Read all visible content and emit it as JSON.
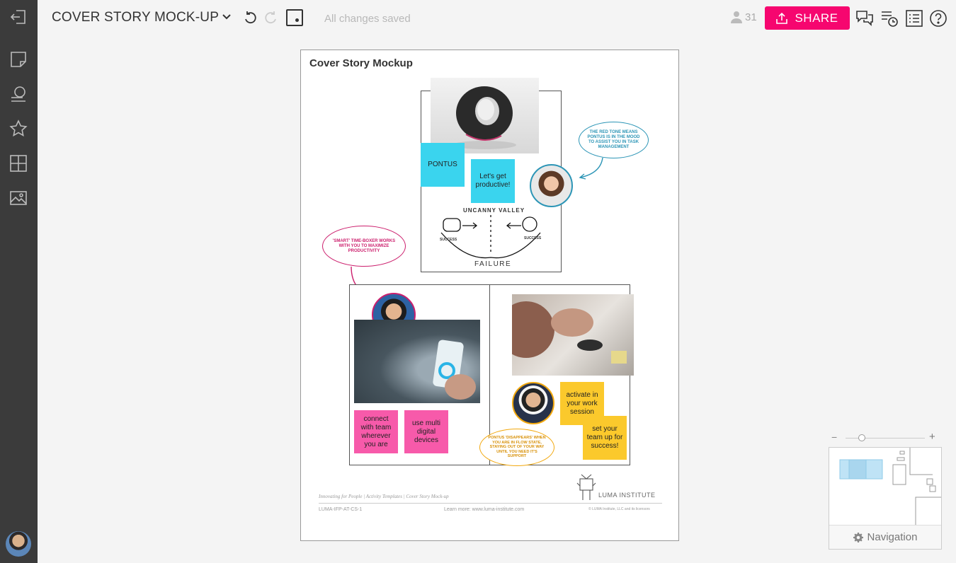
{
  "header": {
    "title": "COVER STORY MOCK-UP",
    "save_status": "All changes saved",
    "user_count": "31",
    "share_label": "SHARE"
  },
  "board": {
    "title": "Cover Story Mockup",
    "stickies": {
      "pontus": "PONTUS",
      "productive": "Let's get productive!",
      "connect": "connect with team wherever you are",
      "multi": "use multi digital devices",
      "activate": "activate in your work session",
      "setup": "set your team up for success!"
    },
    "bubbles": {
      "red_tone": "The red tone means Pontus is in the mood to assist you in task management",
      "smart": "'Smart' time-boxer works with you to maximize productivity",
      "disappears": "Pontus 'disappears' when you are in flow state, staying out of your way until you need it's support"
    },
    "sketch": {
      "top_label": "UNCANNY VALLEY",
      "bottom_label": "FAILURE",
      "left_label": "SUCCESS",
      "right_label": "SUCCESS"
    },
    "footer": {
      "left": "Innovating for People | Activity Templates | Cover Story Mock-up",
      "code": "LUMA-IFP-AT-CS-1",
      "learn_more": "Learn more: www.luma-institute.com",
      "copyright": "© LUMA Institute, LLC and its licensors",
      "logo_text": "LUMA INSTITUTE"
    }
  },
  "navigation": {
    "label": "Navigation",
    "zoom_minus": "−",
    "zoom_plus": "+"
  },
  "colors": {
    "accent": "#f6066f",
    "sidebar": "#3b3b3b",
    "cyan_sticky": "#3ad4ee",
    "pink_sticky": "#f75aaa",
    "yellow_sticky": "#fbc92c"
  }
}
